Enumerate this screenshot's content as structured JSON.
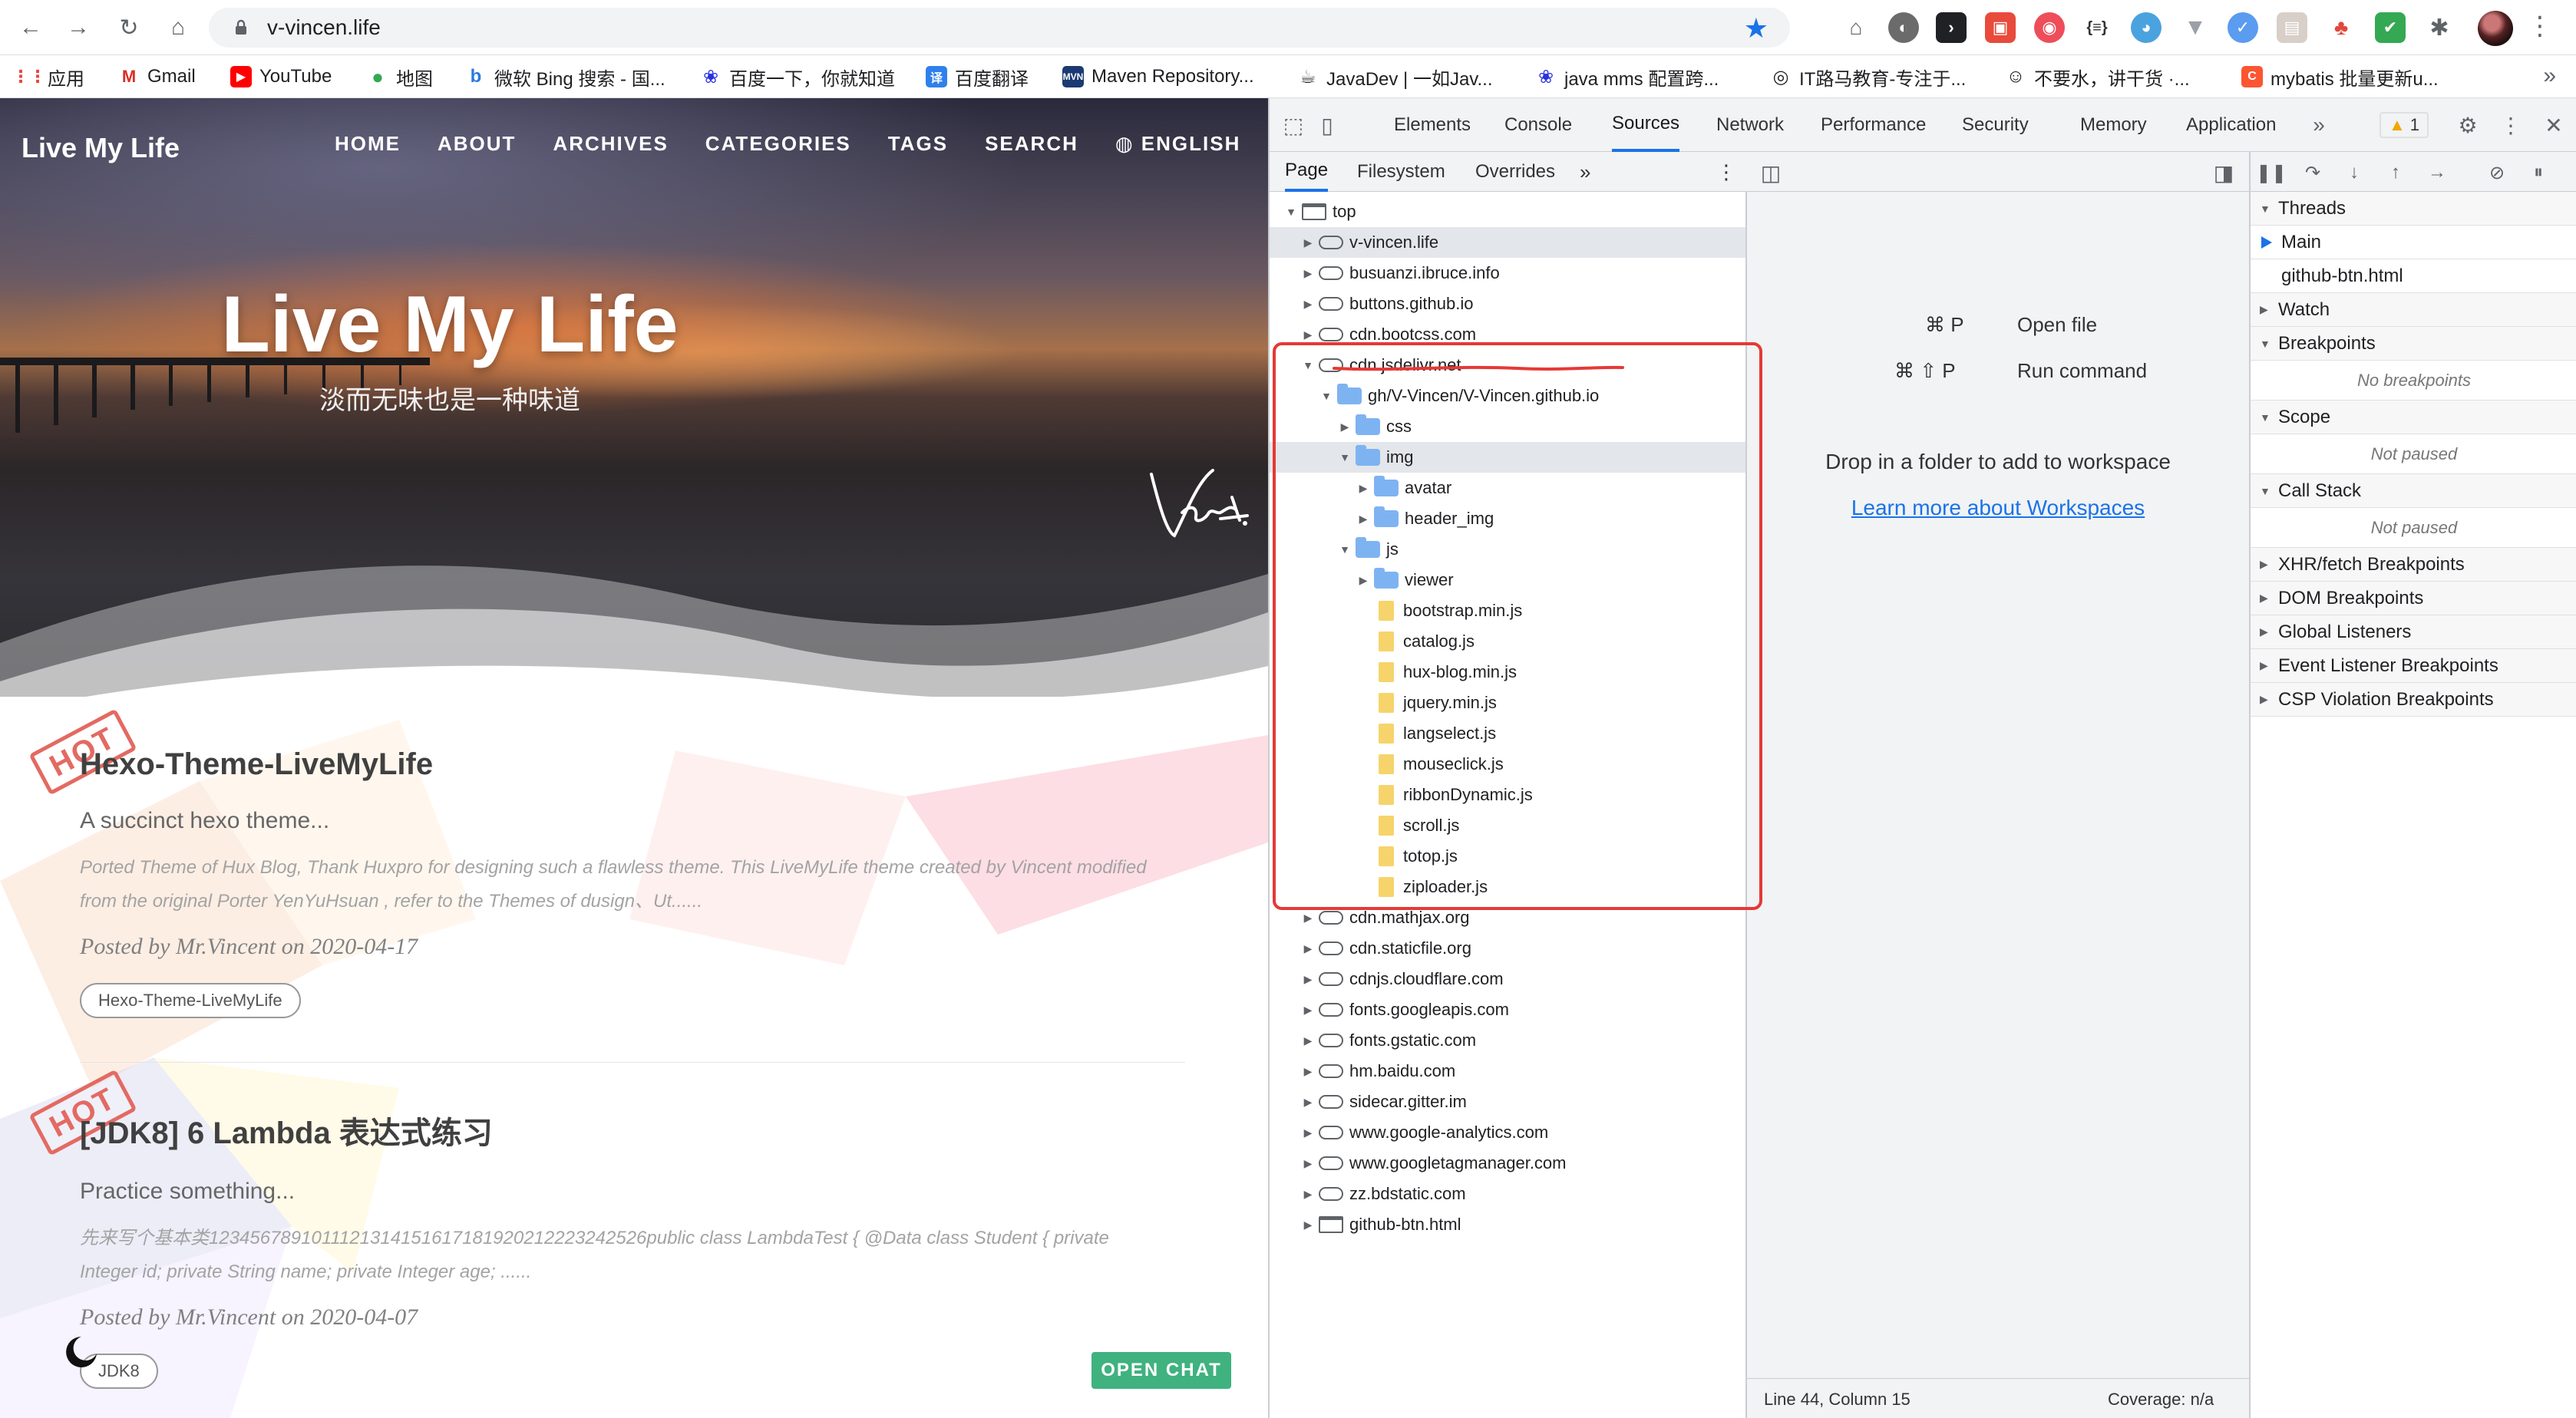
{
  "browser": {
    "url": "v-vincen.life",
    "bookmarks": [
      {
        "label": "应用",
        "icon": "apps-grid-icon",
        "color": "#e8453c"
      },
      {
        "label": "Gmail",
        "icon": "gmail-icon",
        "color": "#d93025"
      },
      {
        "label": "YouTube",
        "icon": "youtube-icon",
        "color": "#ff0000"
      },
      {
        "label": "地图",
        "icon": "maps-pin-icon",
        "color": "#34a853"
      },
      {
        "label": "微软 Bing 搜索 - 国...",
        "icon": "bing-icon",
        "color": "#2a7ae2"
      },
      {
        "label": "百度一下，你就知道",
        "icon": "baidu-paw-icon",
        "color": "#2932e1"
      },
      {
        "label": "百度翻译",
        "icon": "translate-icon",
        "color": "#2f80ed"
      },
      {
        "label": "Maven Repository...",
        "icon": "maven-icon",
        "color": "#1b3a73"
      },
      {
        "label": "JavaDev | 一如Jav...",
        "icon": "javadev-icon",
        "color": "#333333"
      },
      {
        "label": "java mms 配置跨...",
        "icon": "baidu-paw-icon",
        "color": "#2932e1"
      },
      {
        "label": "IT路马教育-专注于...",
        "icon": "itlma-icon",
        "color": "#222222"
      },
      {
        "label": "不要水，讲干货 ·...",
        "icon": "zhihu-icon",
        "color": "#111111"
      },
      {
        "label": "mybatis 批量更新u...",
        "icon": "csdn-icon",
        "color": "#fc5531"
      }
    ]
  },
  "site": {
    "brand": "Live My Life",
    "nav": [
      "HOME",
      "ABOUT",
      "ARCHIVES",
      "CATEGORIES",
      "TAGS",
      "SEARCH",
      "ENGLISH"
    ],
    "hero_title": "Live My Life",
    "hero_subtitle": "淡而无味也是一种味道",
    "hot_label": "HOT",
    "posts": [
      {
        "title": "Hexo-Theme-LiveMyLife",
        "subtitle": "A succinct hexo theme...",
        "excerpt": "Ported Theme of Hux Blog, Thank Huxpro for designing such a flawless theme. This LiveMyLife theme created by Vincent modified from the original Porter YenYuHsuan , refer to the Themes of dusign、Ut......",
        "meta": "Posted by Mr.Vincent on 2020-04-17",
        "tag": "Hexo-Theme-LiveMyLife"
      },
      {
        "title": "[JDK8] 6 Lambda 表达式练习",
        "subtitle": "Practice something...",
        "excerpt": "先来写个基本类1234567891011121314151617181920212223242526public class LambdaTest { @Data class Student { private Integer id; private String name; private Integer age; ......",
        "meta": "Posted by Mr.Vincent on 2020-04-07",
        "tag": "JDK8"
      }
    ],
    "open_chat": "OPEN CHAT"
  },
  "devtools": {
    "tabs": [
      "Elements",
      "Console",
      "Sources",
      "Network",
      "Performance",
      "Security",
      "Memory",
      "Application"
    ],
    "active_tab": "Sources",
    "warning_count": "1",
    "subtabs": [
      "Page",
      "Filesystem",
      "Overrides"
    ],
    "tree": [
      {
        "label": "top",
        "icon": "frame",
        "depth": 0,
        "arrow": "down"
      },
      {
        "label": "v-vincen.life",
        "icon": "cloud",
        "depth": 1,
        "arrow": "right",
        "selected": true
      },
      {
        "label": "busuanzi.ibruce.info",
        "icon": "cloud",
        "depth": 1,
        "arrow": "right"
      },
      {
        "label": "buttons.github.io",
        "icon": "cloud",
        "depth": 1,
        "arrow": "right"
      },
      {
        "label": "cdn.bootcss.com",
        "icon": "cloud",
        "depth": 1,
        "arrow": "right"
      },
      {
        "label": "cdn.jsdelivr.net",
        "icon": "cloud",
        "depth": 1,
        "arrow": "down"
      },
      {
        "label": "gh/V-Vincen/V-Vincen.github.io",
        "icon": "folder",
        "depth": 2,
        "arrow": "down"
      },
      {
        "label": "css",
        "icon": "folder",
        "depth": 3,
        "arrow": "right"
      },
      {
        "label": "img",
        "icon": "folder",
        "depth": 3,
        "arrow": "down",
        "selected": true
      },
      {
        "label": "avatar",
        "icon": "folder",
        "depth": 4,
        "arrow": "right"
      },
      {
        "label": "header_img",
        "icon": "folder",
        "depth": 4,
        "arrow": "right"
      },
      {
        "label": "js",
        "icon": "folder",
        "depth": 3,
        "arrow": "down"
      },
      {
        "label": "viewer",
        "icon": "folder",
        "depth": 4,
        "arrow": "right"
      },
      {
        "label": "bootstrap.min.js",
        "icon": "file",
        "depth": 4,
        "arrow": ""
      },
      {
        "label": "catalog.js",
        "icon": "file",
        "depth": 4,
        "arrow": ""
      },
      {
        "label": "hux-blog.min.js",
        "icon": "file",
        "depth": 4,
        "arrow": ""
      },
      {
        "label": "jquery.min.js",
        "icon": "file",
        "depth": 4,
        "arrow": ""
      },
      {
        "label": "langselect.js",
        "icon": "file",
        "depth": 4,
        "arrow": ""
      },
      {
        "label": "mouseclick.js",
        "icon": "file",
        "depth": 4,
        "arrow": ""
      },
      {
        "label": "ribbonDynamic.js",
        "icon": "file",
        "depth": 4,
        "arrow": ""
      },
      {
        "label": "scroll.js",
        "icon": "file",
        "depth": 4,
        "arrow": ""
      },
      {
        "label": "totop.js",
        "icon": "file",
        "depth": 4,
        "arrow": ""
      },
      {
        "label": "ziploader.js",
        "icon": "file",
        "depth": 4,
        "arrow": ""
      },
      {
        "label": "cdn.mathjax.org",
        "icon": "cloud",
        "depth": 1,
        "arrow": "right"
      },
      {
        "label": "cdn.staticfile.org",
        "icon": "cloud",
        "depth": 1,
        "arrow": "right"
      },
      {
        "label": "cdnjs.cloudflare.com",
        "icon": "cloud",
        "depth": 1,
        "arrow": "right"
      },
      {
        "label": "fonts.googleapis.com",
        "icon": "cloud",
        "depth": 1,
        "arrow": "right"
      },
      {
        "label": "fonts.gstatic.com",
        "icon": "cloud",
        "depth": 1,
        "arrow": "right"
      },
      {
        "label": "hm.baidu.com",
        "icon": "cloud",
        "depth": 1,
        "arrow": "right"
      },
      {
        "label": "sidecar.gitter.im",
        "icon": "cloud",
        "depth": 1,
        "arrow": "right"
      },
      {
        "label": "www.google-analytics.com",
        "icon": "cloud",
        "depth": 1,
        "arrow": "right"
      },
      {
        "label": "www.googletagmanager.com",
        "icon": "cloud",
        "depth": 1,
        "arrow": "right"
      },
      {
        "label": "zz.bdstatic.com",
        "icon": "cloud",
        "depth": 1,
        "arrow": "right"
      },
      {
        "label": "github-btn.html",
        "icon": "frame",
        "depth": 1,
        "arrow": "right"
      }
    ],
    "editor": {
      "open_file_keys": "⌘ P",
      "open_file_label": "Open file",
      "run_command_keys": "⌘ ⇧ P",
      "run_command_label": "Run command",
      "drop_text": "Drop in a folder to add to workspace",
      "learn_link": "Learn more about Workspaces",
      "status_position": "Line 44, Column 15",
      "status_coverage": "Coverage: n/a"
    },
    "debugger": {
      "threads_label": "Threads",
      "threads": [
        "Main",
        "github-btn.html"
      ],
      "watch_label": "Watch",
      "breakpoints_label": "Breakpoints",
      "no_breakpoints": "No breakpoints",
      "scope_label": "Scope",
      "scope_status": "Not paused",
      "callstack_label": "Call Stack",
      "callstack_status": "Not paused",
      "sections": [
        "XHR/fetch Breakpoints",
        "DOM Breakpoints",
        "Global Listeners",
        "Event Listener Breakpoints",
        "CSP Violation Breakpoints"
      ]
    }
  }
}
